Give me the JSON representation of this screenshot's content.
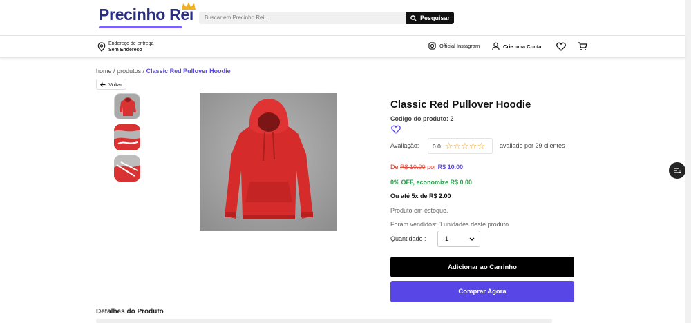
{
  "header": {
    "logo": "Precinho Rei",
    "search_placeholder": "Buscar em Precinho Rei...",
    "search_button": "Pesquisar",
    "address_label": "Endereço de entrega",
    "address_value": "Sem Endereço",
    "instagram": "Official Instagram",
    "account": "Crie uma Conta"
  },
  "breadcrumb": {
    "home": "home",
    "sep": "/",
    "products": "produtos",
    "current": "Classic Red Pullover Hoodie"
  },
  "back_label": "Voltar",
  "product": {
    "title": "Classic Red Pullover Hoodie",
    "code": "Codigo do produto: 2",
    "rating_label": "Avaliação:",
    "rating_value": "0.0",
    "stars_filled": 0,
    "stars_total": 5,
    "rating_count": "avaliado por 29 clientes",
    "price_from_label": "De",
    "price_old": "R$ 10.00",
    "price_por_label": "por",
    "price_new": "R$ 10.00",
    "discount": "0% OFF, economize R$ 0.00",
    "installments": "Ou até 5x de R$ 2.00",
    "stock": "Produto em estoque.",
    "sold": "Foram vendidos: 0 unidades deste produto",
    "quantity_label": "Quantidade :",
    "quantity_value": "1",
    "add_to_cart": "Adicionar ao Carrinho",
    "buy_now": "Comprar Agora"
  },
  "details_title": "Detalhes do Produto",
  "colors": {
    "brand": "#2b2f83",
    "accent": "#5847e6",
    "discount": "#2a9d4a",
    "old_price": "#e74c3c",
    "hoodie": "#d93232"
  }
}
